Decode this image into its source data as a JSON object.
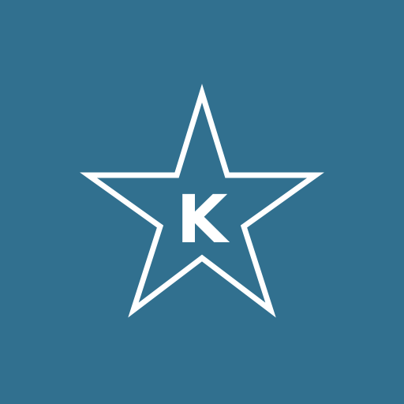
{
  "logo": {
    "name": "star-k-kosher-symbol",
    "letter": "K",
    "icon": "star-outline-icon"
  },
  "colors": {
    "background": "#31708F",
    "foreground": "#FFFFFF"
  }
}
